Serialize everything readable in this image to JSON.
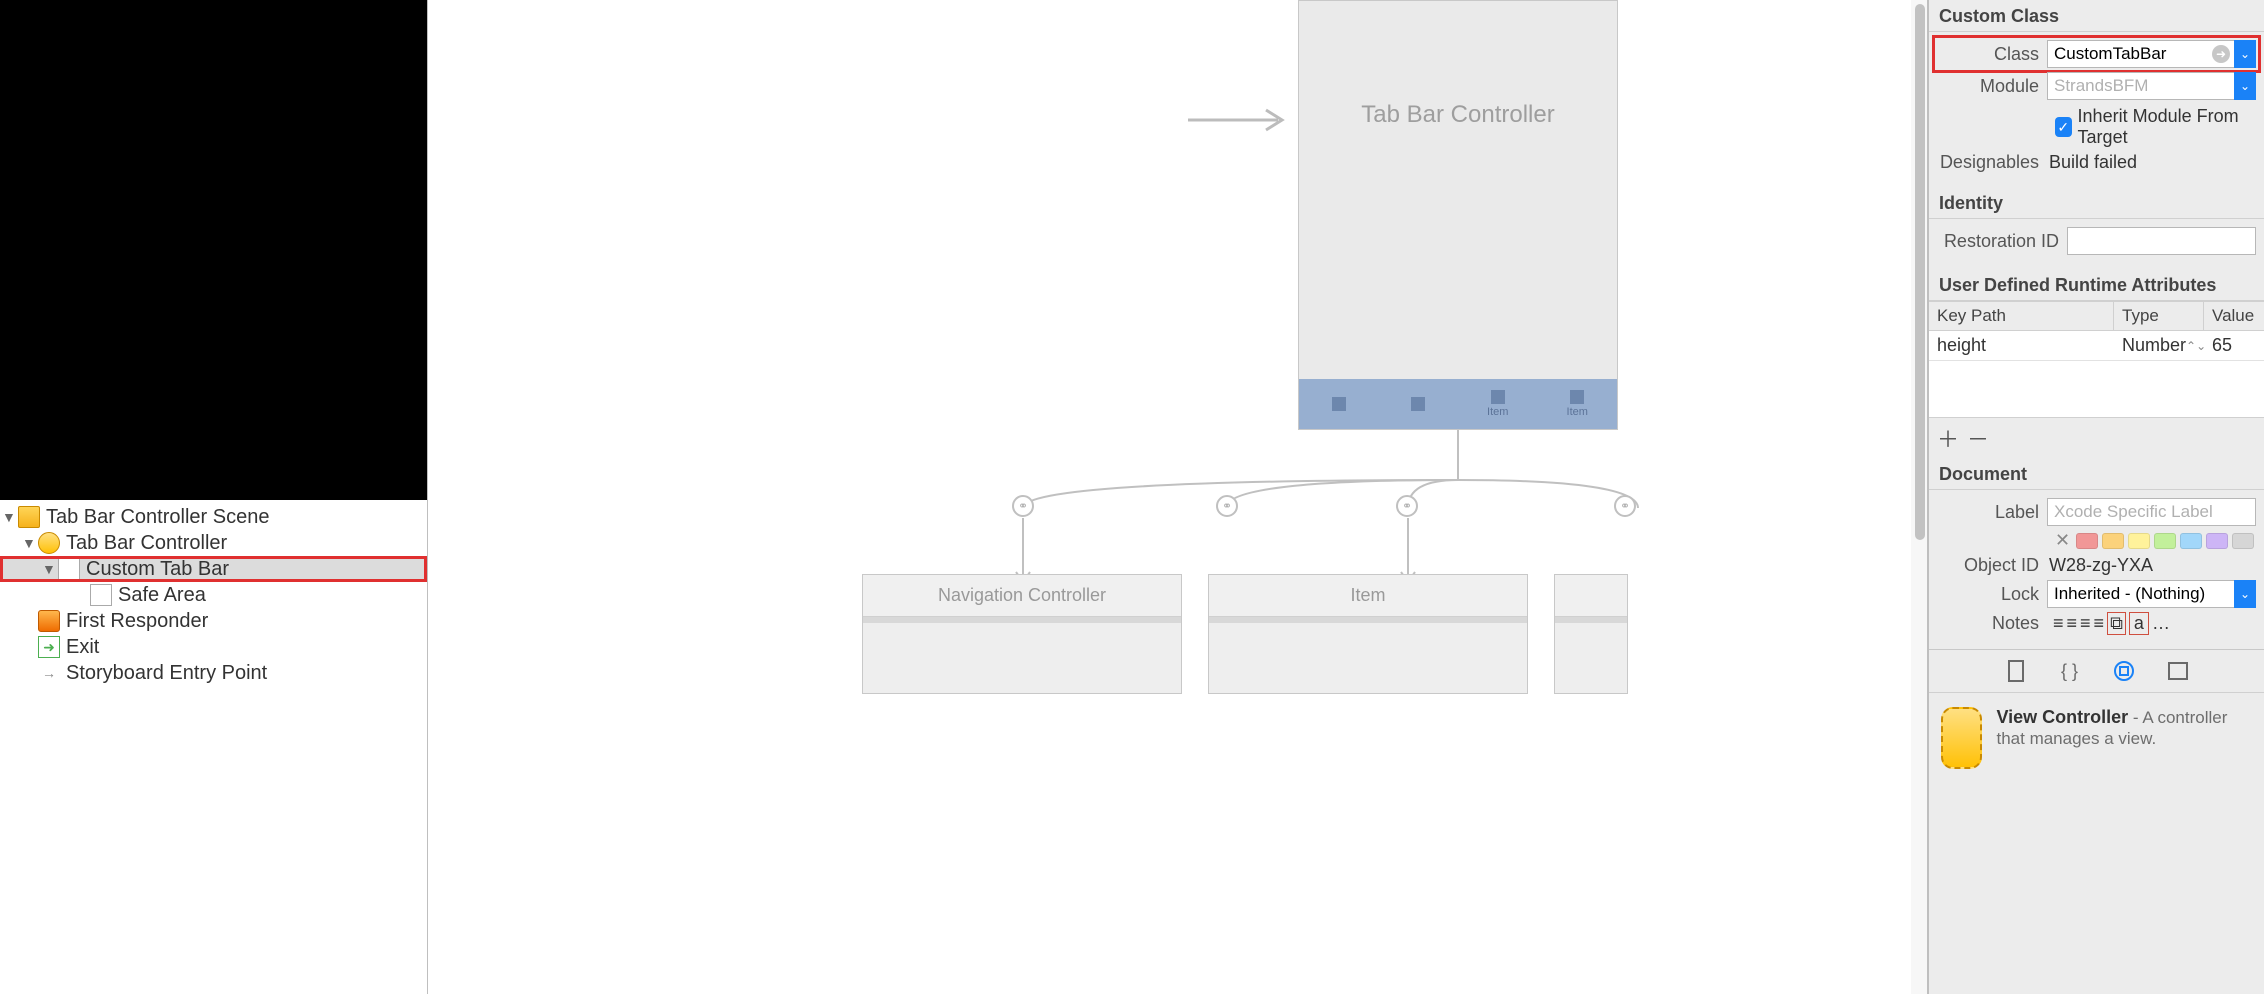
{
  "sidebar": {
    "tree": [
      {
        "label": "Tab Bar Controller Scene",
        "indent": 0,
        "disclosure": "▼",
        "icon": "scene-icon"
      },
      {
        "label": "Tab Bar Controller",
        "indent": 1,
        "disclosure": "▼",
        "icon": "tabbar-controller-icon"
      },
      {
        "label": "Custom Tab Bar",
        "indent": 2,
        "disclosure": "▼",
        "icon": "tabbar-icon",
        "selected": true,
        "highlighted": true
      },
      {
        "label": "Safe Area",
        "indent": 3,
        "disclosure": "",
        "icon": "safearea-icon"
      },
      {
        "label": "First Responder",
        "indent": 1,
        "disclosure": "",
        "icon": "first-responder-icon"
      },
      {
        "label": "Exit",
        "indent": 1,
        "disclosure": "",
        "icon": "exit-icon"
      },
      {
        "label": "Storyboard Entry Point",
        "indent": 1,
        "disclosure": "",
        "icon": "entry-arrow-icon"
      }
    ]
  },
  "canvas": {
    "controllerTitle": "Tab Bar Controller",
    "tabItems": [
      "",
      "",
      "Item",
      "Item"
    ],
    "cards": [
      "Navigation Controller",
      "Item"
    ]
  },
  "inspector": {
    "customClass": {
      "header": "Custom Class",
      "classLabel": "Class",
      "classValue": "CustomTabBar",
      "moduleLabel": "Module",
      "modulePlaceholder": "StrandsBFM",
      "inheritLabel": "Inherit Module From Target",
      "designablesLabel": "Designables",
      "designablesValue": "Build failed"
    },
    "identity": {
      "header": "Identity",
      "restorationLabel": "Restoration ID",
      "restorationValue": ""
    },
    "runtimeAttrs": {
      "header": "User Defined Runtime Attributes",
      "cols": {
        "keypath": "Key Path",
        "type": "Type",
        "value": "Value"
      },
      "row": {
        "keypath": "height",
        "type": "Number",
        "value": "65"
      }
    },
    "document": {
      "header": "Document",
      "labelLabel": "Label",
      "labelPlaceholder": "Xcode Specific Label",
      "colors": [
        "#f19797",
        "#fbd27b",
        "#fff29b",
        "#c2f09b",
        "#a2d7fa",
        "#cdb5f6",
        "#d6d6d6"
      ],
      "objectIdLabel": "Object ID",
      "objectIdValue": "W28-zg-YXA",
      "lockLabel": "Lock",
      "lockValue": "Inherited - (Nothing)",
      "notesLabel": "Notes"
    },
    "library": {
      "itemTitle": "View Controller",
      "itemDesc": " - A controller that manages a view."
    }
  }
}
